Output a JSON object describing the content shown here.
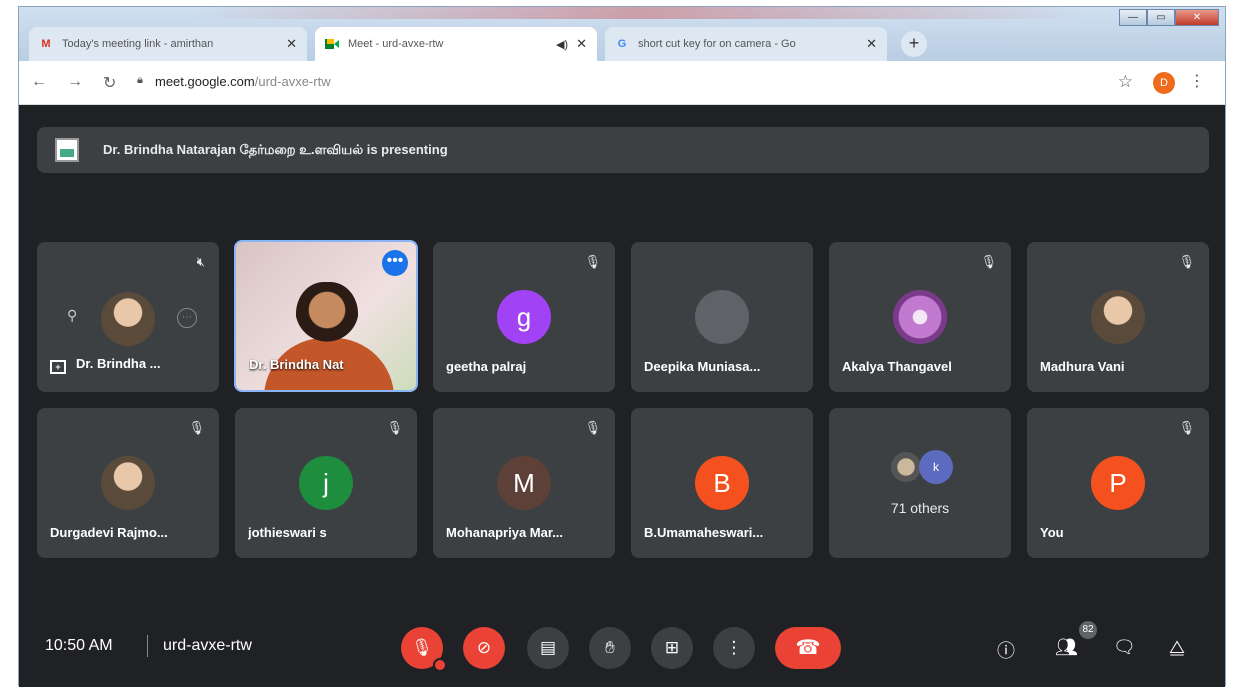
{
  "browser": {
    "tabs": [
      {
        "title": "Today's meeting link - amirthan",
        "favicon": "gmail-icon"
      },
      {
        "title": "Meet - urd-avxe-rtw",
        "favicon": "meet-icon"
      },
      {
        "title": "short cut key for on camera - Go",
        "favicon": "google-icon"
      }
    ],
    "url_host": "meet.google.com",
    "url_path": "/urd-avxe-rtw",
    "profile_initial": "D"
  },
  "meet": {
    "presenting_banner": "Dr. Brindha Natarajan தேர்மறை உ.ளவியல் is presenting",
    "participants": [
      {
        "name": "Dr. Brindha ..."
      },
      {
        "name": "Dr. Brindha Nat"
      },
      {
        "name": "geetha palraj",
        "initial": "g",
        "color": "#a142f4"
      },
      {
        "name": "Deepika Muniasa..."
      },
      {
        "name": "Akalya Thangavel"
      },
      {
        "name": "Madhura Vani"
      },
      {
        "name": "Durgadevi Rajmo..."
      },
      {
        "name": "jothieswari s",
        "initial": "j",
        "color": "#1e8e3e"
      },
      {
        "name": "Mohanapriya Mar...",
        "initial": "M",
        "color": "#5d4037"
      },
      {
        "name": "B.Umamaheswari...",
        "initial": "B",
        "color": "#f4511e"
      },
      {
        "name": "71 others",
        "initial": "k",
        "color": "#5c6bc0"
      },
      {
        "name": "You",
        "initial": "P",
        "color": "#f4511e"
      }
    ],
    "time": "10:50 AM",
    "meeting_code": "urd-avxe-rtw",
    "people_count": "82"
  },
  "colors": {
    "leave": "#ea4335",
    "active_speaker_border": "#8ab4f8",
    "background": "#202124"
  }
}
